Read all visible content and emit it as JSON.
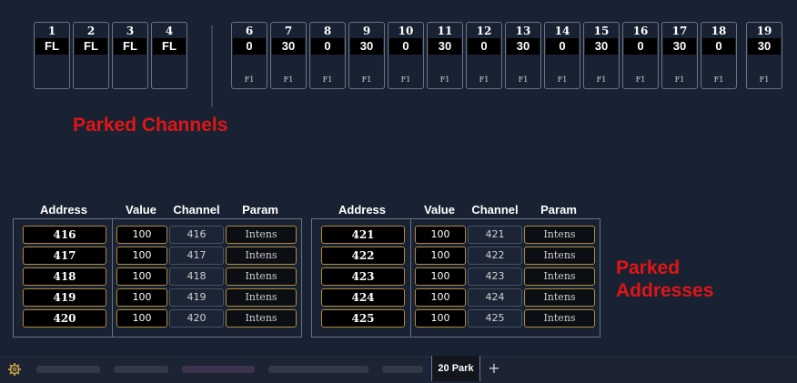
{
  "parked_channels": {
    "annotation": "Parked Channels",
    "channels": [
      {
        "number": "1",
        "value": "FL",
        "param": ""
      },
      {
        "number": "2",
        "value": "FL",
        "param": ""
      },
      {
        "number": "3",
        "value": "FL",
        "param": ""
      },
      {
        "number": "4",
        "value": "FL",
        "param": ""
      },
      {
        "number": "6",
        "value": "0",
        "param": "F1"
      },
      {
        "number": "7",
        "value": "30",
        "param": "F1"
      },
      {
        "number": "8",
        "value": "0",
        "param": "F1"
      },
      {
        "number": "9",
        "value": "30",
        "param": "F1"
      },
      {
        "number": "10",
        "value": "0",
        "param": "F1"
      },
      {
        "number": "11",
        "value": "30",
        "param": "F1"
      },
      {
        "number": "12",
        "value": "0",
        "param": "F1"
      },
      {
        "number": "13",
        "value": "30",
        "param": "F1"
      },
      {
        "number": "14",
        "value": "0",
        "param": "F1"
      },
      {
        "number": "15",
        "value": "30",
        "param": "F1"
      },
      {
        "number": "16",
        "value": "0",
        "param": "F1"
      },
      {
        "number": "17",
        "value": "30",
        "param": "F1"
      },
      {
        "number": "18",
        "value": "0",
        "param": "F1"
      },
      {
        "number": "19",
        "value": "30",
        "param": "F1"
      }
    ]
  },
  "parked_addresses": {
    "annotation_line1": "Parked",
    "annotation_line2": "Addresses",
    "headers": {
      "address": "Address",
      "value": "Value",
      "channel": "Channel",
      "param": "Param"
    },
    "tables": [
      {
        "rows": [
          {
            "address": "416",
            "value": "100",
            "channel": "416",
            "param": "Intens"
          },
          {
            "address": "417",
            "value": "100",
            "channel": "417",
            "param": "Intens"
          },
          {
            "address": "418",
            "value": "100",
            "channel": "418",
            "param": "Intens"
          },
          {
            "address": "419",
            "value": "100",
            "channel": "419",
            "param": "Intens"
          },
          {
            "address": "420",
            "value": "100",
            "channel": "420",
            "param": "Intens"
          }
        ]
      },
      {
        "rows": [
          {
            "address": "421",
            "value": "100",
            "channel": "421",
            "param": "Intens"
          },
          {
            "address": "422",
            "value": "100",
            "channel": "422",
            "param": "Intens"
          },
          {
            "address": "423",
            "value": "100",
            "channel": "423",
            "param": "Intens"
          },
          {
            "address": "424",
            "value": "100",
            "channel": "424",
            "param": "Intens"
          },
          {
            "address": "425",
            "value": "100",
            "channel": "425",
            "param": "Intens"
          }
        ]
      }
    ]
  },
  "tabbar": {
    "active_tab": "20 Park",
    "add_label": "+",
    "settings_icon": "gear-icon"
  },
  "colors": {
    "background": "#182232",
    "annotation": "#e01515",
    "cell_border": "#b08a3c"
  }
}
